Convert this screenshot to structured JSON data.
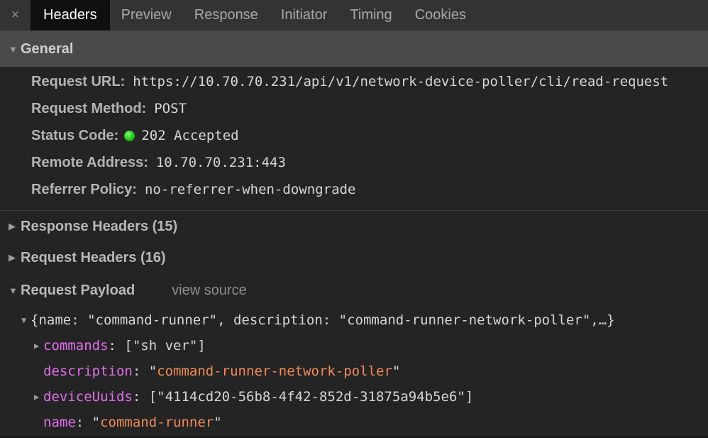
{
  "tabs": {
    "close_icon": "×",
    "items": [
      "Headers",
      "Preview",
      "Response",
      "Initiator",
      "Timing",
      "Cookies"
    ],
    "active": "Headers"
  },
  "general": {
    "title": "General",
    "request_url_label": "Request URL:",
    "request_url": "https://10.70.70.231/api/v1/network-device-poller/cli/read-request",
    "request_method_label": "Request Method:",
    "request_method": "POST",
    "status_code_label": "Status Code:",
    "status_code": "202 Accepted",
    "status_color": "#27c21a",
    "remote_address_label": "Remote Address:",
    "remote_address": "10.70.70.231:443",
    "referrer_policy_label": "Referrer Policy:",
    "referrer_policy": "no-referrer-when-downgrade"
  },
  "response_headers": {
    "title": "Response Headers (15)"
  },
  "request_headers": {
    "title": "Request Headers (16)"
  },
  "payload": {
    "title": "Request Payload",
    "view_source": "view source",
    "summary": "{name: \"command-runner\", description: \"command-runner-network-poller\",…}",
    "commands_key": "commands",
    "commands_value": "[\"sh ver\"]",
    "description_key": "description",
    "description_value": "command-runner-network-poller",
    "device_uuids_key": "deviceUuids",
    "device_uuids_value": "[\"4114cd20-56b8-4f42-852d-31875a94b5e6\"]",
    "name_key": "name",
    "name_value": "command-runner"
  },
  "colors": {
    "property_key": "#e36eec",
    "string_value": "#f28b54",
    "active_tab_bg": "#0f0f0f",
    "general_header_bg": "#4a4a4a"
  },
  "icons": {
    "expanded": "triangle-down-icon",
    "collapsed": "triangle-right-icon",
    "close": "close-icon"
  }
}
